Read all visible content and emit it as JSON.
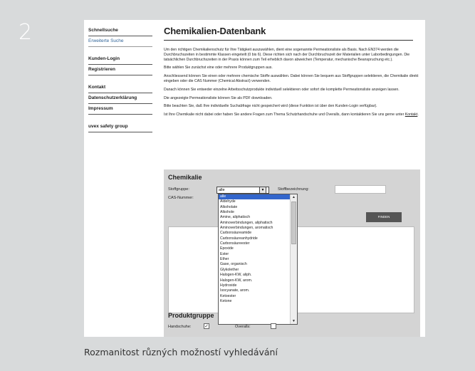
{
  "step_number": "2",
  "caption": "Rozmanitost různých možností vyhledávání",
  "nav": {
    "items": [
      {
        "label": "Schnellsuche",
        "type": "main"
      },
      {
        "label": "Erweiterte Suche",
        "type": "sub"
      },
      {
        "label": "Kunden-Login",
        "type": "main"
      },
      {
        "label": "Registrieren",
        "type": "main"
      },
      {
        "label": "Kontakt",
        "type": "main"
      },
      {
        "label": "Datenschutzerklärung",
        "type": "main"
      },
      {
        "label": "Impressum",
        "type": "main"
      },
      {
        "label": "uvex safety group",
        "type": "main"
      }
    ]
  },
  "main": {
    "title": "Chemikalien-Datenbank",
    "paragraphs": [
      "Um den richtigen Chemikalienschutz für Ihre Tätigkeit auszuwählen, dient eine sogenannte Permeationsliste als Basis. Nach EN374 werden die Durchbruchszeiten in bestimmte Klassen eingeteilt (0 bis 6). Diese richten sich nach der Durchbruchszeit der Materialien unter Laborbedingungen. Die tatsächlichen Durchbruchszeiten in der Praxis können zum Teil erheblich davon abweichen (Temperatur, mechanische Beanspruchung etc.).",
      "Bitte wählen Sie zunächst eine oder mehrere Produktgruppen aus.",
      "Anschliessend können Sie einen oder mehrere chemische Stoffe auswählen. Dabei können Sie bequem aus Stoffgruppen selektieren, die Chemikalie direkt eingeben oder die CAS Nummer (Chemical Abstract) verwenden.",
      "Danach können Sie entweder einzelne Arbeitsschutzprodukte individuell selektieren oder sofort die komplette Permeationsliste anzeigen lassen.",
      "Die angezeigte Permeationsliste können Sie als PDF downloaden.",
      "Bitte beachten Sie, daß Ihre individuelle Suchabfrage nicht gespeichert wird (diese Funktion ist über den Kunden-Login verfügbar)."
    ],
    "last_para_text": "Ist Ihre Chemikalie nicht dabei oder haben Sie andere Fragen zum Thema Schutzhandschuhe und Overalls, dann kontaktieren Sie uns gerne unter",
    "last_para_link": "Kontakt"
  },
  "form": {
    "heading": "Chemikalie",
    "stoffgruppe_label": "Stoffgruppe:",
    "stoffgruppe_value": "alle",
    "stoffbezeichnung_label": "Stoffbezeichnung:",
    "cas_label": "CAS-Nummer:",
    "find_button": "FINDEN",
    "dropdown_options": [
      "alle",
      "Aldehyde",
      "Alkoholate",
      "Alkohole",
      "Amine, aliphatisch",
      "Aminoverbindungen, aliphatisch",
      "Aminoverbindungen, aromatisch",
      "Carbonsäureamide",
      "Carbonsäureanhydride",
      "Carbonsäureester",
      "Epoxide",
      "Ester",
      "Ether",
      "Gase, organisch",
      "Glykolether",
      "Halogen-KW, aliph.",
      "Halogen-KW, arom.",
      "Hydroxide",
      "Isocyanate, arom.",
      "Ketoester",
      "Ketone"
    ],
    "produktgruppe_heading": "Produktgruppe",
    "handschuhe_label": "Handschuhe:",
    "handschuhe_checked": "✓",
    "overalls_label": "Overalls:"
  }
}
